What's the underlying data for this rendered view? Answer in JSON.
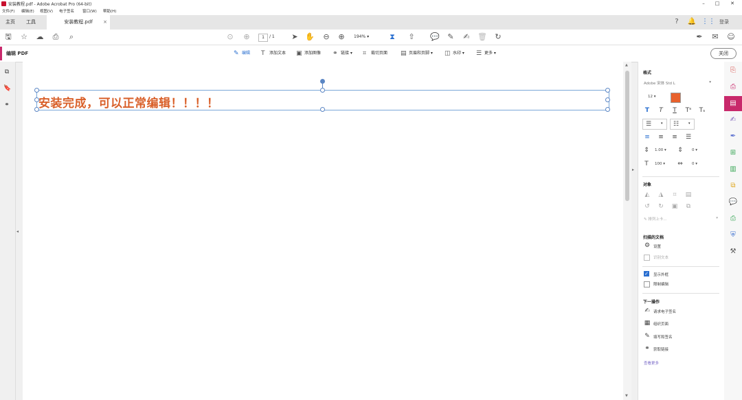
{
  "window": {
    "title": "安装教程.pdf - Adobe Acrobat Pro (64-bit)",
    "controls": [
      "–",
      "□",
      "✕"
    ]
  },
  "menu": [
    "文件(F)",
    "编辑(E)",
    "视图(V)",
    "电子签名",
    "窗口(W)",
    "帮助(H)"
  ],
  "tabs": {
    "home": "主页",
    "tools": "工具",
    "document": "安装教程.pdf",
    "doc_close": "×"
  },
  "toolbar": {
    "page_current": "1",
    "page_total": "/ 1",
    "zoom": "194%"
  },
  "edit_bar": {
    "mode_label": "编辑 PDF",
    "tools": [
      "编辑",
      "添加文本",
      "添加图像",
      "链接",
      "裁切页面",
      "页眉和页脚",
      "水印",
      "更多"
    ],
    "close_label": "关闭"
  },
  "document": {
    "text": "安装完成，可以正常编辑！！！！",
    "text_color": "#d9602a"
  },
  "right_panel": {
    "format_heading": "格式",
    "font": "Adobe 宋体 Std L",
    "font_size": "12",
    "font_color": "#e8612c",
    "line_spacing": "1.00",
    "para_spacing": "0",
    "char_scale": "100",
    "char_spacing": "0",
    "objects_heading": "对象",
    "arrange_label": "排列上卡...",
    "scanned_heading": "扫描的文档",
    "settings_label": "设置",
    "recognize_label": "识别文本",
    "show_bbox_label": "显示外框",
    "restrict_label": "限制编辑",
    "show_bbox_checked": true,
    "next_heading": "下一操作",
    "next_actions": [
      "请求电子签名",
      "组织页面",
      "填写和签名",
      "获取链接"
    ],
    "more_link": "查看更多"
  },
  "tool_rail_colors": [
    "#d9534f",
    "#c8296b",
    "#c8296b",
    "#7b5cb8",
    "#5a6fd0",
    "#3aa757",
    "#3aa757",
    "#e0a820",
    "#e0a820",
    "#3aa757",
    "#3a6fd0",
    "#555555"
  ],
  "colors": {
    "accent": "#c8296b",
    "selection": "#7aa7d8"
  }
}
